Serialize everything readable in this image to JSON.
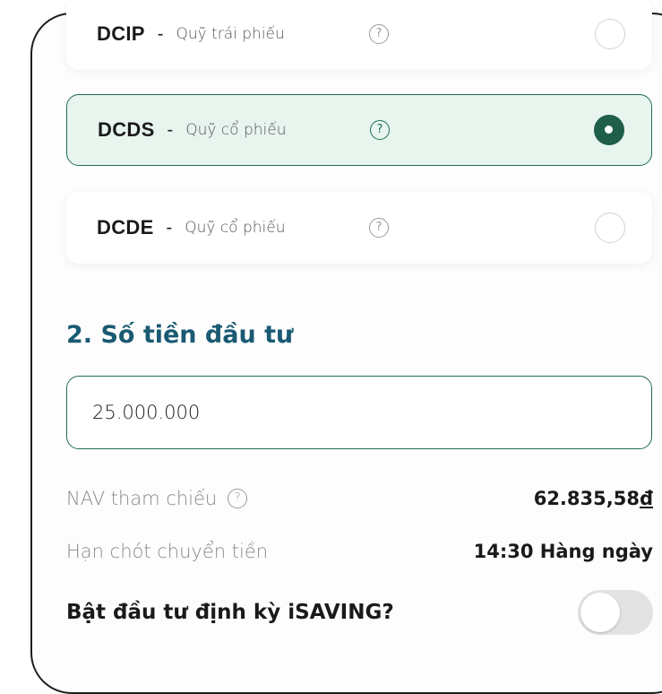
{
  "funds": [
    {
      "code": "DCIP",
      "dash": "-",
      "name": "Quỹ trái phiếu",
      "help": "?",
      "selected": false
    },
    {
      "code": "DCDS",
      "dash": "-",
      "name": "Quỹ cổ phiếu",
      "help": "?",
      "selected": true
    },
    {
      "code": "DCDE",
      "dash": "-",
      "name": "Quỹ cổ phiếu",
      "help": "?",
      "selected": false
    }
  ],
  "investment": {
    "title": "2. Số tiền đầu tư",
    "amount": "25.000.000"
  },
  "nav": {
    "label": "NAV tham chiếu",
    "help": "?",
    "value": "62.835,58",
    "currency": "đ"
  },
  "deadline": {
    "label": "Hạn chót chuyển tiền",
    "value": "14:30 Hàng ngày"
  },
  "isaving": {
    "label": "Bật đầu tư định kỳ iSAVING?",
    "enabled": false
  },
  "colors": {
    "accent": "#1f6d52",
    "selected_bg": "#e8f4ee",
    "title": "#1a5a73"
  }
}
